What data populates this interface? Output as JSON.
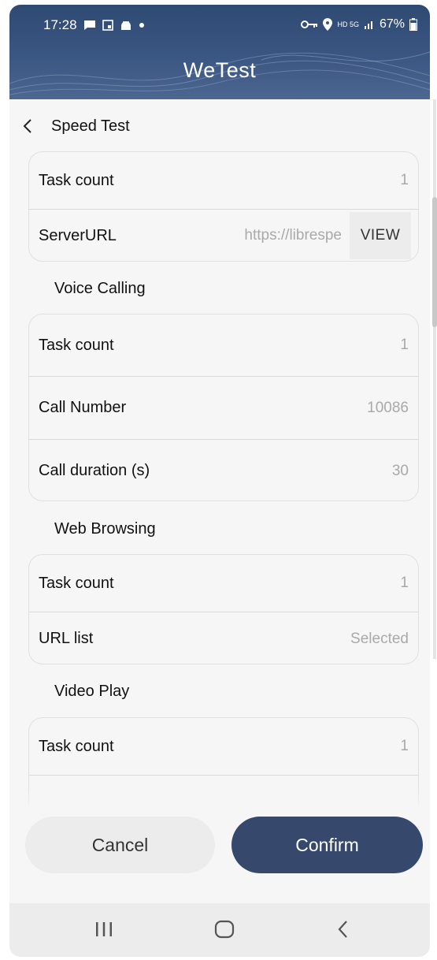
{
  "status_bar": {
    "time": "17:28",
    "network_label": "HD 5G",
    "battery": "67%",
    "left_icons": [
      "message-icon",
      "screenshot-icon",
      "android-icon",
      "dot-icon"
    ],
    "right_icons": [
      "vpn-key-icon",
      "location-icon",
      "signal-icon",
      "battery-icon"
    ]
  },
  "app": {
    "title": "WeTest"
  },
  "nav": {
    "title": "Speed Test"
  },
  "speed_test": {
    "task_count_label": "Task count",
    "task_count_value": "1",
    "server_url_label": "ServerURL",
    "server_url_value": "https://librespe",
    "view_label": "VIEW"
  },
  "voice_calling": {
    "header": "Voice Calling",
    "task_count_label": "Task count",
    "task_count_value": "1",
    "call_number_label": "Call Number",
    "call_number_value": "10086",
    "call_duration_label": "Call duration (s)",
    "call_duration_value": "30"
  },
  "web_browsing": {
    "header": "Web Browsing",
    "task_count_label": "Task count",
    "task_count_value": "1",
    "url_list_label": "URL list",
    "url_list_value": "Selected"
  },
  "video_play": {
    "header": "Video Play",
    "task_count_label": "Task count",
    "task_count_value": "1"
  },
  "actions": {
    "cancel": "Cancel",
    "confirm": "Confirm"
  },
  "colors": {
    "header": "#36496d",
    "confirm_button": "#36496d",
    "background": "#f6f6f6"
  }
}
